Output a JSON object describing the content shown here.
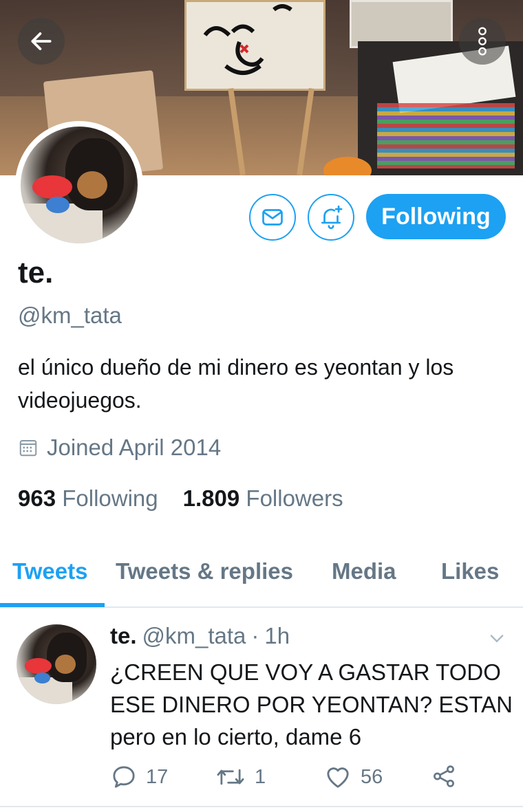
{
  "profile": {
    "name": "te.",
    "handle": "@km_tata",
    "bio": "el único dueño de mi dinero es yeontan y los videojuegos.",
    "joined": "Joined April 2014",
    "following_count": "963",
    "following_label": "Following",
    "followers_count": "1.809",
    "followers_label": "Followers",
    "follow_button_label": "Following"
  },
  "header": {
    "back_icon": "arrow-left-icon",
    "more_icon": "more-vertical-icon"
  },
  "actions": {
    "message_icon": "envelope-icon",
    "notification_icon": "bell-plus-icon"
  },
  "tabs": [
    {
      "label": "Tweets",
      "active": true
    },
    {
      "label": "Tweets & replies",
      "active": false
    },
    {
      "label": "Media",
      "active": false
    },
    {
      "label": "Likes",
      "active": false
    }
  ],
  "tweet": {
    "name": "te.",
    "handle": "@km_tata",
    "separator": "·",
    "time": "1h",
    "text": "¿CREEN QUE VOY A GASTAR TODO ESE DINERO POR YEONTAN? ESTAN pero en lo cierto, dame 6",
    "replies": "17",
    "retweets": "1",
    "likes": "56"
  },
  "colors": {
    "accent": "#1da1f2",
    "secondary_text": "#657786",
    "primary_text": "#14171a"
  }
}
